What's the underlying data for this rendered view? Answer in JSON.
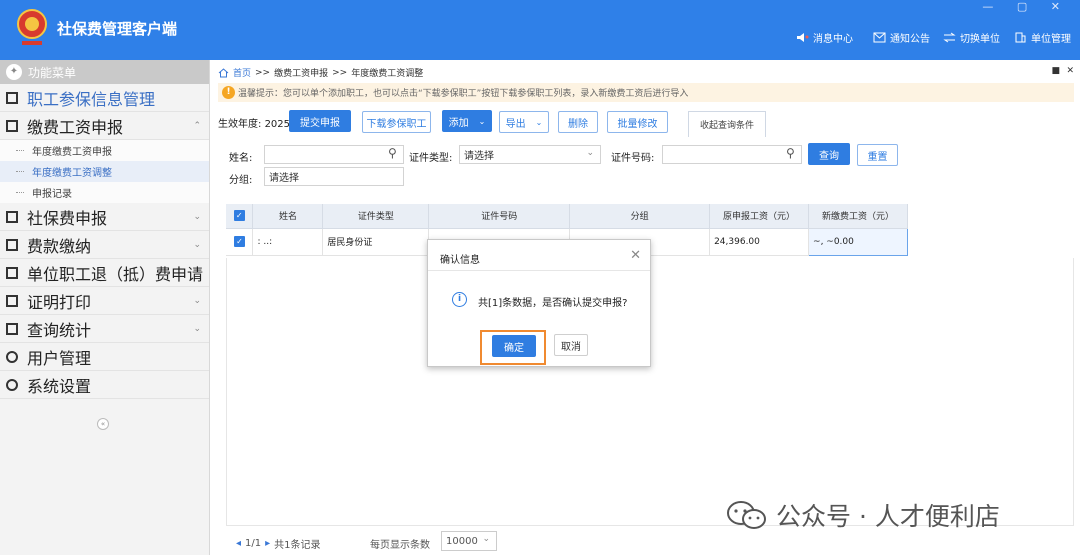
{
  "app": {
    "title": "社保费管理客户端",
    "window_controls": "— ▢ ✕"
  },
  "top_nav": [
    {
      "label": "消息中心",
      "icon": "speaker-icon"
    },
    {
      "label": "通知公告",
      "icon": "mail-icon"
    },
    {
      "label": "切换单位",
      "icon": "switch-icon"
    },
    {
      "label": "单位管理",
      "icon": "building-icon"
    }
  ],
  "sidebar": {
    "header": "功能菜单",
    "items": [
      {
        "label": "职工参保信息管理"
      },
      {
        "label": "缴费工资申报"
      },
      {
        "label": "社保费申报"
      },
      {
        "label": "费款缴纳"
      },
      {
        "label": "单位职工退（抵）费申请"
      },
      {
        "label": "证明打印"
      },
      {
        "label": "查询统计"
      },
      {
        "label": "用户管理"
      },
      {
        "label": "系统设置"
      }
    ],
    "sub_items": [
      "年度缴费工资申报",
      "年度缴费工资调整",
      "申报记录"
    ]
  },
  "breadcrumb": {
    "home": "首页",
    "sep": ">>",
    "level1": "缴费工资申报",
    "level2": "年度缴费工资调整"
  },
  "tip": "温馨提示：您可以单个添加职工，也可以点击“下载参保职工”按钮下载参保职工列表，录入新缴费工资后进行导入",
  "toolbar": {
    "year_label": "生效年度:",
    "year_value": "2025",
    "submit": "提交申报",
    "download": "下载参保职工",
    "add": "添加",
    "export": "导出",
    "delete": "删除",
    "batch_edit": "批量修改",
    "collapse_query": "收起查询条件"
  },
  "search": {
    "name_label": "姓名:",
    "id_type_label": "证件类型:",
    "id_type_value": "请选择",
    "id_no_label": "证件号码:",
    "query": "查询",
    "reset": "重置",
    "group_label": "分组:",
    "group_value": "请选择"
  },
  "table": {
    "headers": [
      "姓名",
      "证件类型",
      "证件号码",
      "分组",
      "原申报工资（元）",
      "新缴费工资（元）"
    ],
    "rows": [
      {
        "name": ": ..:",
        "id_type": "居民身份证",
        "id_no": "",
        "group": "",
        "orig_wage": "24,396.00",
        "new_wage": "~, ~0.00"
      }
    ]
  },
  "pagination": {
    "page": "1/1",
    "total": "共1条记录",
    "per_page_label": "每页显示条数",
    "per_page_value": "10000"
  },
  "dialog": {
    "title": "确认信息",
    "message": "共[1]条数据，是否确认提交申报?",
    "ok": "确定",
    "cancel": "取消"
  },
  "watermark": "公众号 · 人才便利店",
  "colors": {
    "brand": "#2f80e8",
    "highlight": "#f08a30",
    "tip_bg": "#fdf3e2"
  }
}
